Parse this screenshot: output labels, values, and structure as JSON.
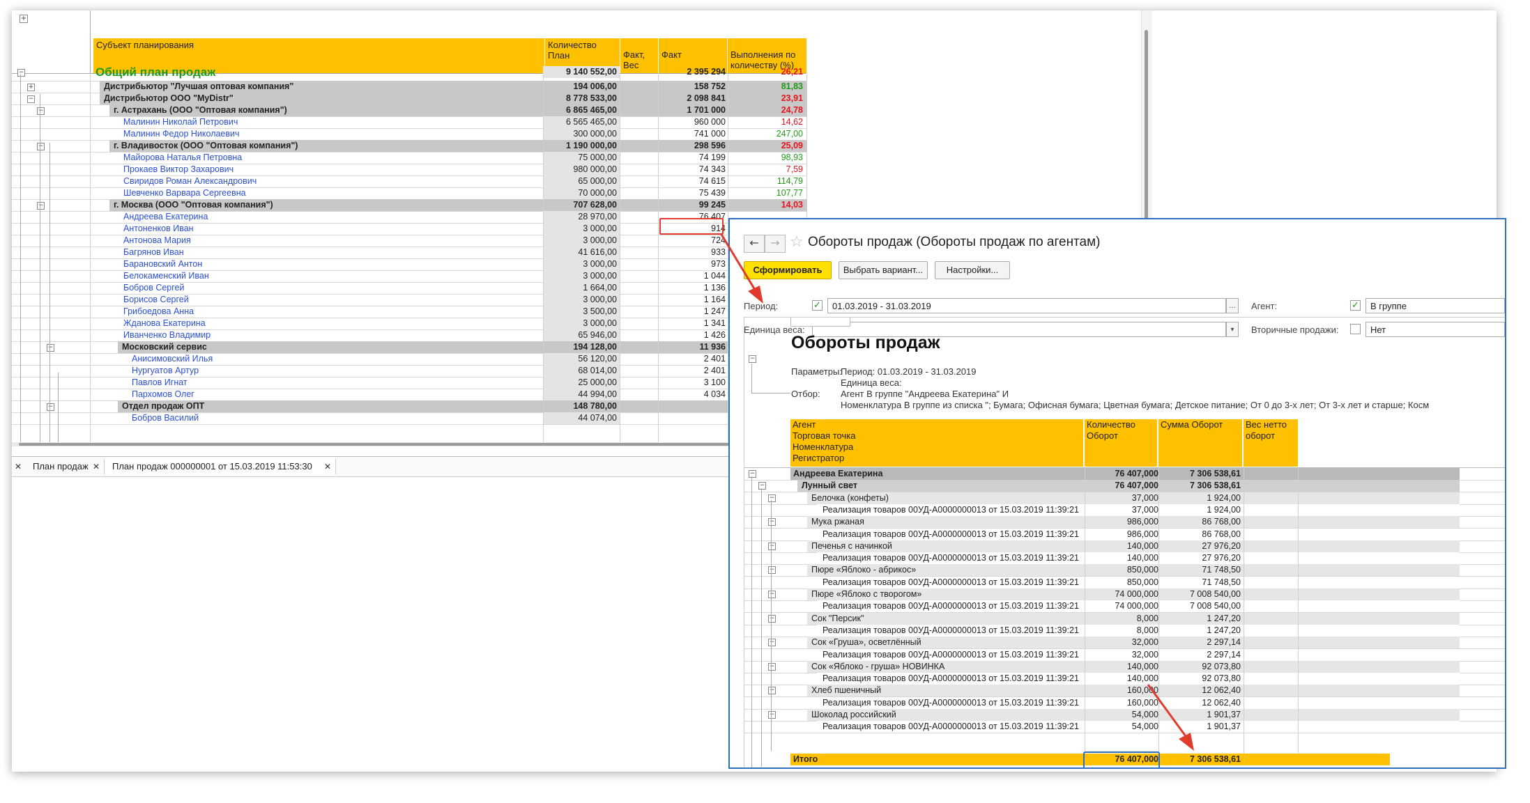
{
  "main": {
    "headers": {
      "subject": "Субъект планирования",
      "qty": "Количество",
      "plan": "План",
      "fact_ves_1": "Факт,",
      "fact_ves_2": "Вес",
      "fact": "Факт",
      "exec_1": "Выполнения по",
      "exec_2": "количеству (%)"
    },
    "rows": [
      {
        "name": "Общий план продаж",
        "plan": "9 140 552,00",
        "fact": "2 395 294",
        "pct": "26,21",
        "style": "top",
        "pc": "red"
      },
      {
        "name": "Дистрибьютор \"Лучшая оптовая компания\"",
        "plan": "194 006,00",
        "fact": "158 752",
        "pct": "81,83",
        "style": "g1",
        "pc": "green"
      },
      {
        "name": "Дистрибьютор ООО \"MyDistr\"",
        "plan": "8 778 533,00",
        "fact": "2 098 841",
        "pct": "23,91",
        "style": "g1",
        "pc": "red"
      },
      {
        "name": "г. Астрахань (ООО \"Оптовая компания\")",
        "plan": "6 865 465,00",
        "fact": "1 701 000",
        "pct": "24,78",
        "style": "g2",
        "pc": "red"
      },
      {
        "name": "Малинин Николай Петрович",
        "plan": "6 565 465,00",
        "fact": "960 000",
        "pct": "14,62",
        "style": "i3",
        "pc": "red"
      },
      {
        "name": "Малинин Федор Николаевич",
        "plan": "300 000,00",
        "fact": "741 000",
        "pct": "247,00",
        "style": "i3",
        "pc": "green"
      },
      {
        "name": "г. Владивосток (ООО \"Оптовая компания\")",
        "plan": "1 190 000,00",
        "fact": "298 596",
        "pct": "25,09",
        "style": "g2",
        "pc": "red"
      },
      {
        "name": "Майорова Наталья Петровна",
        "plan": "75 000,00",
        "fact": "74 199",
        "pct": "98,93",
        "style": "i3",
        "pc": "green"
      },
      {
        "name": "Прокаев Виктор Захарович",
        "plan": "980 000,00",
        "fact": "74 343",
        "pct": "7,59",
        "style": "i3",
        "pc": "red"
      },
      {
        "name": "Свиридов Роман Александрович",
        "plan": "65 000,00",
        "fact": "74 615",
        "pct": "114,79",
        "style": "i3",
        "pc": "green"
      },
      {
        "name": "Шевченко Варвара Сергеевна",
        "plan": "70 000,00",
        "fact": "75 439",
        "pct": "107,77",
        "style": "i3",
        "pc": "green"
      },
      {
        "name": "г. Москва  (ООО \"Оптовая компания\")",
        "plan": "707 628,00",
        "fact": "99 245",
        "pct": "14,03",
        "style": "g2",
        "pc": "red"
      },
      {
        "name": "Андреева Екатерина",
        "plan": "28 970,00",
        "fact": "76 407",
        "pct": "",
        "style": "i3",
        "pc": ""
      },
      {
        "name": "Антоненков Иван",
        "plan": "3 000,00",
        "fact": "914",
        "pct": "",
        "style": "i3",
        "pc": ""
      },
      {
        "name": "Антонова Мария",
        "plan": "3 000,00",
        "fact": "724",
        "pct": "",
        "style": "i3",
        "pc": ""
      },
      {
        "name": "Багрянов Иван",
        "plan": "41 616,00",
        "fact": "933",
        "pct": "",
        "style": "i3",
        "pc": ""
      },
      {
        "name": "Барановский Антон",
        "plan": "3 000,00",
        "fact": "973",
        "pct": "",
        "style": "i3",
        "pc": ""
      },
      {
        "name": "Белокаменский Иван",
        "plan": "3 000,00",
        "fact": "1 044",
        "pct": "",
        "style": "i3",
        "pc": ""
      },
      {
        "name": "Бобров Сергей",
        "plan": "1 664,00",
        "fact": "1 136",
        "pct": "",
        "style": "i3",
        "pc": ""
      },
      {
        "name": "Борисов Сергей",
        "plan": "3 000,00",
        "fact": "1 164",
        "pct": "",
        "style": "i3",
        "pc": ""
      },
      {
        "name": "Грибоедова Анна",
        "plan": "3 500,00",
        "fact": "1 247",
        "pct": "",
        "style": "i3",
        "pc": ""
      },
      {
        "name": "Жданова Екатерина",
        "plan": "3 000,00",
        "fact": "1 341",
        "pct": "",
        "style": "i3",
        "pc": ""
      },
      {
        "name": "Иванченко Владимир",
        "plan": "65 946,00",
        "fact": "1 426",
        "pct": "",
        "style": "i3",
        "pc": ""
      },
      {
        "name": "Московский сервис",
        "plan": "194 128,00",
        "fact": "11 936",
        "pct": "",
        "style": "g3",
        "pc": ""
      },
      {
        "name": "Анисимовский Илья",
        "plan": "56 120,00",
        "fact": "2 401",
        "pct": "",
        "style": "i4",
        "pc": ""
      },
      {
        "name": "Нургуатов Артур",
        "plan": "68 014,00",
        "fact": "2 401",
        "pct": "",
        "style": "i4",
        "pc": ""
      },
      {
        "name": "Павлов Игнат",
        "plan": "25 000,00",
        "fact": "3 100",
        "pct": "",
        "style": "i4",
        "pc": ""
      },
      {
        "name": "Пархомов Олег",
        "plan": "44 994,00",
        "fact": "4 034",
        "pct": "",
        "style": "i4",
        "pc": ""
      },
      {
        "name": "Отдел продаж ОПТ",
        "plan": "148 780,00",
        "fact": "",
        "pct": "",
        "style": "g3",
        "pc": ""
      },
      {
        "name": "Бобров Василий",
        "plan": "44 074,00",
        "fact": "",
        "pct": "",
        "style": "i4",
        "pc": ""
      }
    ],
    "tabs": {
      "tab1": "План продаж",
      "tab2": "План продаж 000000001 от 15.03.2019 11:53:30"
    }
  },
  "popup": {
    "title": "Обороты продаж (Обороты продаж по агентам)",
    "buttons": {
      "generate": "Сформировать",
      "choose_variant": "Выбрать вариант...",
      "settings": "Настройки..."
    },
    "fields": {
      "period_label": "Период:",
      "period_value": "01.03.2019 - 31.03.2019",
      "agent_label": "Агент:",
      "agent_value": "В группе",
      "weight_label": "Единица веса:",
      "weight_value": "",
      "secondary_label": "Вторичные продажи:",
      "secondary_value": "Нет"
    },
    "report": {
      "title": "Обороты продаж",
      "params_label": "Параметры:",
      "params_period": "Период: 01.03.2019 - 31.03.2019",
      "params_weight": "Единица веса:",
      "filter_label": "Отбор:",
      "filter_agent": "Агент В группе \"Андреева Екатерина\" И",
      "filter_nom": "Номенклатура В группе из списка \"; Бумага; Офисная бумага; Цветная бумага; Детское питание; От 0 до 3-х лет; От 3-х лет и старше; Косм",
      "headers": {
        "agent": "Агент",
        "point": "Торговая точка",
        "nom": "Номенклатура",
        "reg": "Регистратор",
        "qty_1": "Количество",
        "qty_2": "Оборот",
        "sum": "Сумма Оборот",
        "ves_1": "Вес нетто",
        "ves_2": "оборот"
      },
      "rows": [
        {
          "name": "Андреева Екатерина",
          "qty": "76 407,000",
          "sum": "7 306 538,61",
          "lvl": 0
        },
        {
          "name": "Лунный свет",
          "qty": "76 407,000",
          "sum": "7 306 538,61",
          "lvl": 1
        },
        {
          "name": "Белочка (конфеты)",
          "qty": "37,000",
          "sum": "1 924,00",
          "lvl": 2
        },
        {
          "name": "Реализация товаров 00УД-А0000000013 от 15.03.2019 11:39:21",
          "qty": "37,000",
          "sum": "1 924,00",
          "lvl": 3
        },
        {
          "name": "Мука ржаная",
          "qty": "986,000",
          "sum": "86 768,00",
          "lvl": 2
        },
        {
          "name": "Реализация товаров 00УД-А0000000013 от 15.03.2019 11:39:21",
          "qty": "986,000",
          "sum": "86 768,00",
          "lvl": 3
        },
        {
          "name": "Печенья с начинкой",
          "qty": "140,000",
          "sum": "27 976,20",
          "lvl": 2
        },
        {
          "name": "Реализация товаров 00УД-А0000000013 от 15.03.2019 11:39:21",
          "qty": "140,000",
          "sum": "27 976,20",
          "lvl": 3
        },
        {
          "name": "Пюре «Яблоко - абрикос»",
          "qty": "850,000",
          "sum": "71 748,50",
          "lvl": 2
        },
        {
          "name": "Реализация товаров 00УД-А0000000013 от 15.03.2019 11:39:21",
          "qty": "850,000",
          "sum": "71 748,50",
          "lvl": 3
        },
        {
          "name": "Пюре «Яблоко с творогом»",
          "qty": "74 000,000",
          "sum": "7 008 540,00",
          "lvl": 2
        },
        {
          "name": "Реализация товаров 00УД-А0000000013 от 15.03.2019 11:39:21",
          "qty": "74 000,000",
          "sum": "7 008 540,00",
          "lvl": 3
        },
        {
          "name": "Сок \"Персик\"",
          "qty": "8,000",
          "sum": "1 247,20",
          "lvl": 2
        },
        {
          "name": "Реализация товаров 00УД-А0000000013 от 15.03.2019 11:39:21",
          "qty": "8,000",
          "sum": "1 247,20",
          "lvl": 3
        },
        {
          "name": "Сок «Груша», осветлённый",
          "qty": "32,000",
          "sum": "2 297,14",
          "lvl": 2
        },
        {
          "name": "Реализация товаров 00УД-А0000000013 от 15.03.2019 11:39:21",
          "qty": "32,000",
          "sum": "2 297,14",
          "lvl": 3
        },
        {
          "name": "Сок «Яблоко - груша» НОВИНКА",
          "qty": "140,000",
          "sum": "92 073,80",
          "lvl": 2
        },
        {
          "name": "Реализация товаров 00УД-А0000000013 от 15.03.2019 11:39:21",
          "qty": "140,000",
          "sum": "92 073,80",
          "lvl": 3
        },
        {
          "name": "Хлеб пшеничный",
          "qty": "160,000",
          "sum": "12 062,40",
          "lvl": 2
        },
        {
          "name": "Реализация товаров 00УД-А0000000013 от 15.03.2019 11:39:21",
          "qty": "160,000",
          "sum": "12 062,40",
          "lvl": 3
        },
        {
          "name": "Шоколад российский",
          "qty": "54,000",
          "sum": "1 901,37",
          "lvl": 2
        },
        {
          "name": "Реализация товаров 00УД-А0000000013 от 15.03.2019 11:39:21",
          "qty": "54,000",
          "sum": "1 901,37",
          "lvl": 3
        }
      ],
      "total": {
        "label": "Итого",
        "qty": "76 407,000",
        "sum": "7 306 538,61"
      }
    }
  },
  "colors": {
    "header": "#ffc000",
    "group": "#c8c8c8",
    "agent": "#2a4fd6",
    "accent_red": "#e8111b",
    "popup_border": "#2e6fbf"
  }
}
